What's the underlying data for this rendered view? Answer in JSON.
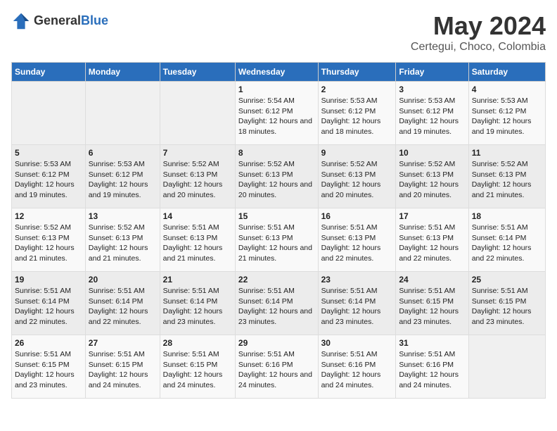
{
  "header": {
    "logo_general": "General",
    "logo_blue": "Blue",
    "title": "May 2024",
    "subtitle": "Certegui, Choco, Colombia"
  },
  "calendar": {
    "days_of_week": [
      "Sunday",
      "Monday",
      "Tuesday",
      "Wednesday",
      "Thursday",
      "Friday",
      "Saturday"
    ],
    "weeks": [
      [
        {
          "day": "",
          "info": ""
        },
        {
          "day": "",
          "info": ""
        },
        {
          "day": "",
          "info": ""
        },
        {
          "day": "1",
          "info": "Sunrise: 5:54 AM\nSunset: 6:12 PM\nDaylight: 12 hours and 18 minutes."
        },
        {
          "day": "2",
          "info": "Sunrise: 5:53 AM\nSunset: 6:12 PM\nDaylight: 12 hours and 18 minutes."
        },
        {
          "day": "3",
          "info": "Sunrise: 5:53 AM\nSunset: 6:12 PM\nDaylight: 12 hours and 19 minutes."
        },
        {
          "day": "4",
          "info": "Sunrise: 5:53 AM\nSunset: 6:12 PM\nDaylight: 12 hours and 19 minutes."
        }
      ],
      [
        {
          "day": "5",
          "info": "Sunrise: 5:53 AM\nSunset: 6:12 PM\nDaylight: 12 hours and 19 minutes."
        },
        {
          "day": "6",
          "info": "Sunrise: 5:53 AM\nSunset: 6:12 PM\nDaylight: 12 hours and 19 minutes."
        },
        {
          "day": "7",
          "info": "Sunrise: 5:52 AM\nSunset: 6:13 PM\nDaylight: 12 hours and 20 minutes."
        },
        {
          "day": "8",
          "info": "Sunrise: 5:52 AM\nSunset: 6:13 PM\nDaylight: 12 hours and 20 minutes."
        },
        {
          "day": "9",
          "info": "Sunrise: 5:52 AM\nSunset: 6:13 PM\nDaylight: 12 hours and 20 minutes."
        },
        {
          "day": "10",
          "info": "Sunrise: 5:52 AM\nSunset: 6:13 PM\nDaylight: 12 hours and 20 minutes."
        },
        {
          "day": "11",
          "info": "Sunrise: 5:52 AM\nSunset: 6:13 PM\nDaylight: 12 hours and 21 minutes."
        }
      ],
      [
        {
          "day": "12",
          "info": "Sunrise: 5:52 AM\nSunset: 6:13 PM\nDaylight: 12 hours and 21 minutes."
        },
        {
          "day": "13",
          "info": "Sunrise: 5:52 AM\nSunset: 6:13 PM\nDaylight: 12 hours and 21 minutes."
        },
        {
          "day": "14",
          "info": "Sunrise: 5:51 AM\nSunset: 6:13 PM\nDaylight: 12 hours and 21 minutes."
        },
        {
          "day": "15",
          "info": "Sunrise: 5:51 AM\nSunset: 6:13 PM\nDaylight: 12 hours and 21 minutes."
        },
        {
          "day": "16",
          "info": "Sunrise: 5:51 AM\nSunset: 6:13 PM\nDaylight: 12 hours and 22 minutes."
        },
        {
          "day": "17",
          "info": "Sunrise: 5:51 AM\nSunset: 6:13 PM\nDaylight: 12 hours and 22 minutes."
        },
        {
          "day": "18",
          "info": "Sunrise: 5:51 AM\nSunset: 6:14 PM\nDaylight: 12 hours and 22 minutes."
        }
      ],
      [
        {
          "day": "19",
          "info": "Sunrise: 5:51 AM\nSunset: 6:14 PM\nDaylight: 12 hours and 22 minutes."
        },
        {
          "day": "20",
          "info": "Sunrise: 5:51 AM\nSunset: 6:14 PM\nDaylight: 12 hours and 22 minutes."
        },
        {
          "day": "21",
          "info": "Sunrise: 5:51 AM\nSunset: 6:14 PM\nDaylight: 12 hours and 23 minutes."
        },
        {
          "day": "22",
          "info": "Sunrise: 5:51 AM\nSunset: 6:14 PM\nDaylight: 12 hours and 23 minutes."
        },
        {
          "day": "23",
          "info": "Sunrise: 5:51 AM\nSunset: 6:14 PM\nDaylight: 12 hours and 23 minutes."
        },
        {
          "day": "24",
          "info": "Sunrise: 5:51 AM\nSunset: 6:15 PM\nDaylight: 12 hours and 23 minutes."
        },
        {
          "day": "25",
          "info": "Sunrise: 5:51 AM\nSunset: 6:15 PM\nDaylight: 12 hours and 23 minutes."
        }
      ],
      [
        {
          "day": "26",
          "info": "Sunrise: 5:51 AM\nSunset: 6:15 PM\nDaylight: 12 hours and 23 minutes."
        },
        {
          "day": "27",
          "info": "Sunrise: 5:51 AM\nSunset: 6:15 PM\nDaylight: 12 hours and 24 minutes."
        },
        {
          "day": "28",
          "info": "Sunrise: 5:51 AM\nSunset: 6:15 PM\nDaylight: 12 hours and 24 minutes."
        },
        {
          "day": "29",
          "info": "Sunrise: 5:51 AM\nSunset: 6:16 PM\nDaylight: 12 hours and 24 minutes."
        },
        {
          "day": "30",
          "info": "Sunrise: 5:51 AM\nSunset: 6:16 PM\nDaylight: 12 hours and 24 minutes."
        },
        {
          "day": "31",
          "info": "Sunrise: 5:51 AM\nSunset: 6:16 PM\nDaylight: 12 hours and 24 minutes."
        },
        {
          "day": "",
          "info": ""
        }
      ]
    ]
  }
}
